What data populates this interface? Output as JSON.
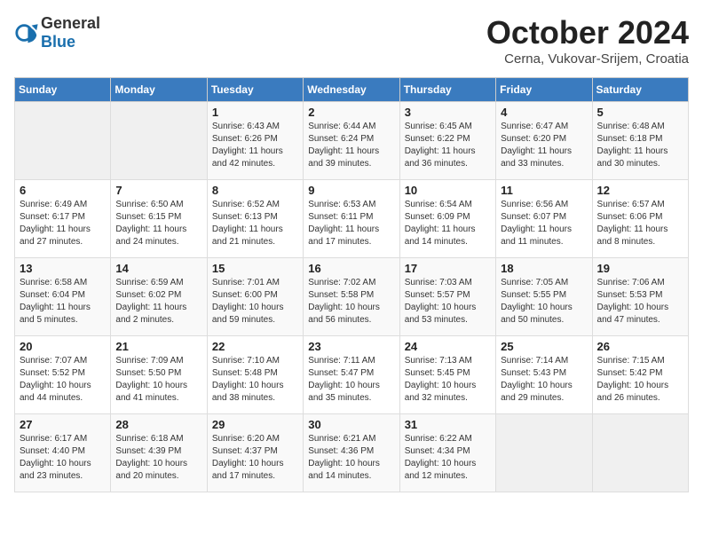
{
  "logo": {
    "text_general": "General",
    "text_blue": "Blue"
  },
  "title": "October 2024",
  "location": "Cerna, Vukovar-Srijem, Croatia",
  "weekdays": [
    "Sunday",
    "Monday",
    "Tuesday",
    "Wednesday",
    "Thursday",
    "Friday",
    "Saturday"
  ],
  "weeks": [
    [
      {
        "day": "",
        "info": ""
      },
      {
        "day": "",
        "info": ""
      },
      {
        "day": "1",
        "info": "Sunrise: 6:43 AM\nSunset: 6:26 PM\nDaylight: 11 hours and 42 minutes."
      },
      {
        "day": "2",
        "info": "Sunrise: 6:44 AM\nSunset: 6:24 PM\nDaylight: 11 hours and 39 minutes."
      },
      {
        "day": "3",
        "info": "Sunrise: 6:45 AM\nSunset: 6:22 PM\nDaylight: 11 hours and 36 minutes."
      },
      {
        "day": "4",
        "info": "Sunrise: 6:47 AM\nSunset: 6:20 PM\nDaylight: 11 hours and 33 minutes."
      },
      {
        "day": "5",
        "info": "Sunrise: 6:48 AM\nSunset: 6:18 PM\nDaylight: 11 hours and 30 minutes."
      }
    ],
    [
      {
        "day": "6",
        "info": "Sunrise: 6:49 AM\nSunset: 6:17 PM\nDaylight: 11 hours and 27 minutes."
      },
      {
        "day": "7",
        "info": "Sunrise: 6:50 AM\nSunset: 6:15 PM\nDaylight: 11 hours and 24 minutes."
      },
      {
        "day": "8",
        "info": "Sunrise: 6:52 AM\nSunset: 6:13 PM\nDaylight: 11 hours and 21 minutes."
      },
      {
        "day": "9",
        "info": "Sunrise: 6:53 AM\nSunset: 6:11 PM\nDaylight: 11 hours and 17 minutes."
      },
      {
        "day": "10",
        "info": "Sunrise: 6:54 AM\nSunset: 6:09 PM\nDaylight: 11 hours and 14 minutes."
      },
      {
        "day": "11",
        "info": "Sunrise: 6:56 AM\nSunset: 6:07 PM\nDaylight: 11 hours and 11 minutes."
      },
      {
        "day": "12",
        "info": "Sunrise: 6:57 AM\nSunset: 6:06 PM\nDaylight: 11 hours and 8 minutes."
      }
    ],
    [
      {
        "day": "13",
        "info": "Sunrise: 6:58 AM\nSunset: 6:04 PM\nDaylight: 11 hours and 5 minutes."
      },
      {
        "day": "14",
        "info": "Sunrise: 6:59 AM\nSunset: 6:02 PM\nDaylight: 11 hours and 2 minutes."
      },
      {
        "day": "15",
        "info": "Sunrise: 7:01 AM\nSunset: 6:00 PM\nDaylight: 10 hours and 59 minutes."
      },
      {
        "day": "16",
        "info": "Sunrise: 7:02 AM\nSunset: 5:58 PM\nDaylight: 10 hours and 56 minutes."
      },
      {
        "day": "17",
        "info": "Sunrise: 7:03 AM\nSunset: 5:57 PM\nDaylight: 10 hours and 53 minutes."
      },
      {
        "day": "18",
        "info": "Sunrise: 7:05 AM\nSunset: 5:55 PM\nDaylight: 10 hours and 50 minutes."
      },
      {
        "day": "19",
        "info": "Sunrise: 7:06 AM\nSunset: 5:53 PM\nDaylight: 10 hours and 47 minutes."
      }
    ],
    [
      {
        "day": "20",
        "info": "Sunrise: 7:07 AM\nSunset: 5:52 PM\nDaylight: 10 hours and 44 minutes."
      },
      {
        "day": "21",
        "info": "Sunrise: 7:09 AM\nSunset: 5:50 PM\nDaylight: 10 hours and 41 minutes."
      },
      {
        "day": "22",
        "info": "Sunrise: 7:10 AM\nSunset: 5:48 PM\nDaylight: 10 hours and 38 minutes."
      },
      {
        "day": "23",
        "info": "Sunrise: 7:11 AM\nSunset: 5:47 PM\nDaylight: 10 hours and 35 minutes."
      },
      {
        "day": "24",
        "info": "Sunrise: 7:13 AM\nSunset: 5:45 PM\nDaylight: 10 hours and 32 minutes."
      },
      {
        "day": "25",
        "info": "Sunrise: 7:14 AM\nSunset: 5:43 PM\nDaylight: 10 hours and 29 minutes."
      },
      {
        "day": "26",
        "info": "Sunrise: 7:15 AM\nSunset: 5:42 PM\nDaylight: 10 hours and 26 minutes."
      }
    ],
    [
      {
        "day": "27",
        "info": "Sunrise: 6:17 AM\nSunset: 4:40 PM\nDaylight: 10 hours and 23 minutes."
      },
      {
        "day": "28",
        "info": "Sunrise: 6:18 AM\nSunset: 4:39 PM\nDaylight: 10 hours and 20 minutes."
      },
      {
        "day": "29",
        "info": "Sunrise: 6:20 AM\nSunset: 4:37 PM\nDaylight: 10 hours and 17 minutes."
      },
      {
        "day": "30",
        "info": "Sunrise: 6:21 AM\nSunset: 4:36 PM\nDaylight: 10 hours and 14 minutes."
      },
      {
        "day": "31",
        "info": "Sunrise: 6:22 AM\nSunset: 4:34 PM\nDaylight: 10 hours and 12 minutes."
      },
      {
        "day": "",
        "info": ""
      },
      {
        "day": "",
        "info": ""
      }
    ]
  ]
}
